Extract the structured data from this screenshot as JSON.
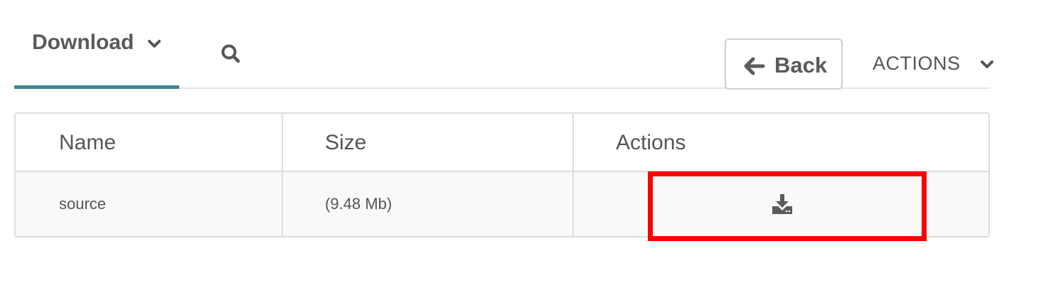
{
  "header": {
    "tab_label": "Download",
    "back_label": "Back",
    "actions_label": "ACTIONS"
  },
  "table": {
    "columns": [
      "Name",
      "Size",
      "Actions"
    ],
    "rows": [
      {
        "name": "source",
        "size": "(9.48 Mb)"
      }
    ]
  },
  "icons": {
    "tab_dropdown": "chevron-down-icon",
    "search": "search-icon",
    "back": "arrow-left-icon",
    "actions_dropdown": "chevron-down-icon",
    "row_action": "download-icon"
  },
  "colors": {
    "tab_underline": "#3d8592",
    "highlight": "#ff0000"
  }
}
